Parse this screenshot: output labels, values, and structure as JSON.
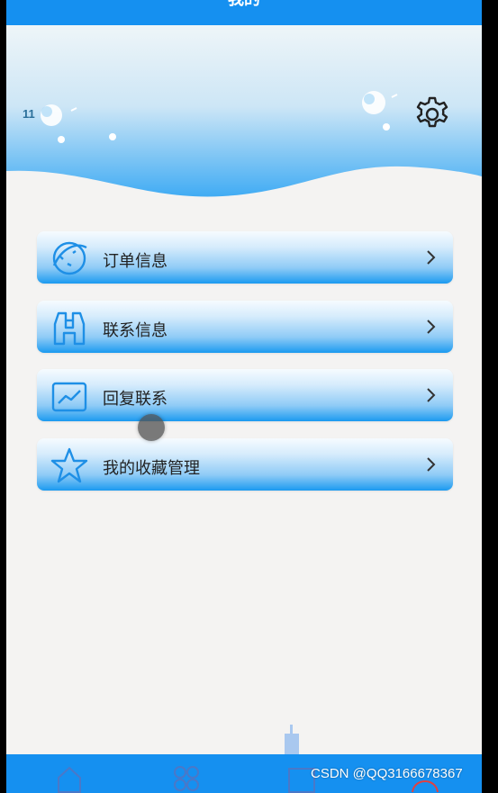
{
  "header": {
    "title": "我的"
  },
  "status": {
    "text": "11"
  },
  "settings": {
    "icon": "gear-icon"
  },
  "menu": [
    {
      "label": "订单信息",
      "icon": "planet-icon"
    },
    {
      "label": "联系信息",
      "icon": "binoculars-icon"
    },
    {
      "label": "回复联系",
      "icon": "chart-icon"
    },
    {
      "label": "我的收藏管理",
      "icon": "star-icon"
    }
  ],
  "tabbar": {
    "tabs": [
      {
        "icon": "home-icon"
      },
      {
        "icon": "grid-icon"
      },
      {
        "icon": "image-icon"
      },
      {
        "icon": "user-icon"
      }
    ]
  },
  "watermark": "CSDN @QQ3166678367",
  "colors": {
    "primary": "#1590f0",
    "background": "#f4f3f2",
    "wave_top": "#eef6fb",
    "wave_bottom": "#2aa2f2",
    "icon_stroke": "#1e8fe6",
    "text": "#222222"
  }
}
